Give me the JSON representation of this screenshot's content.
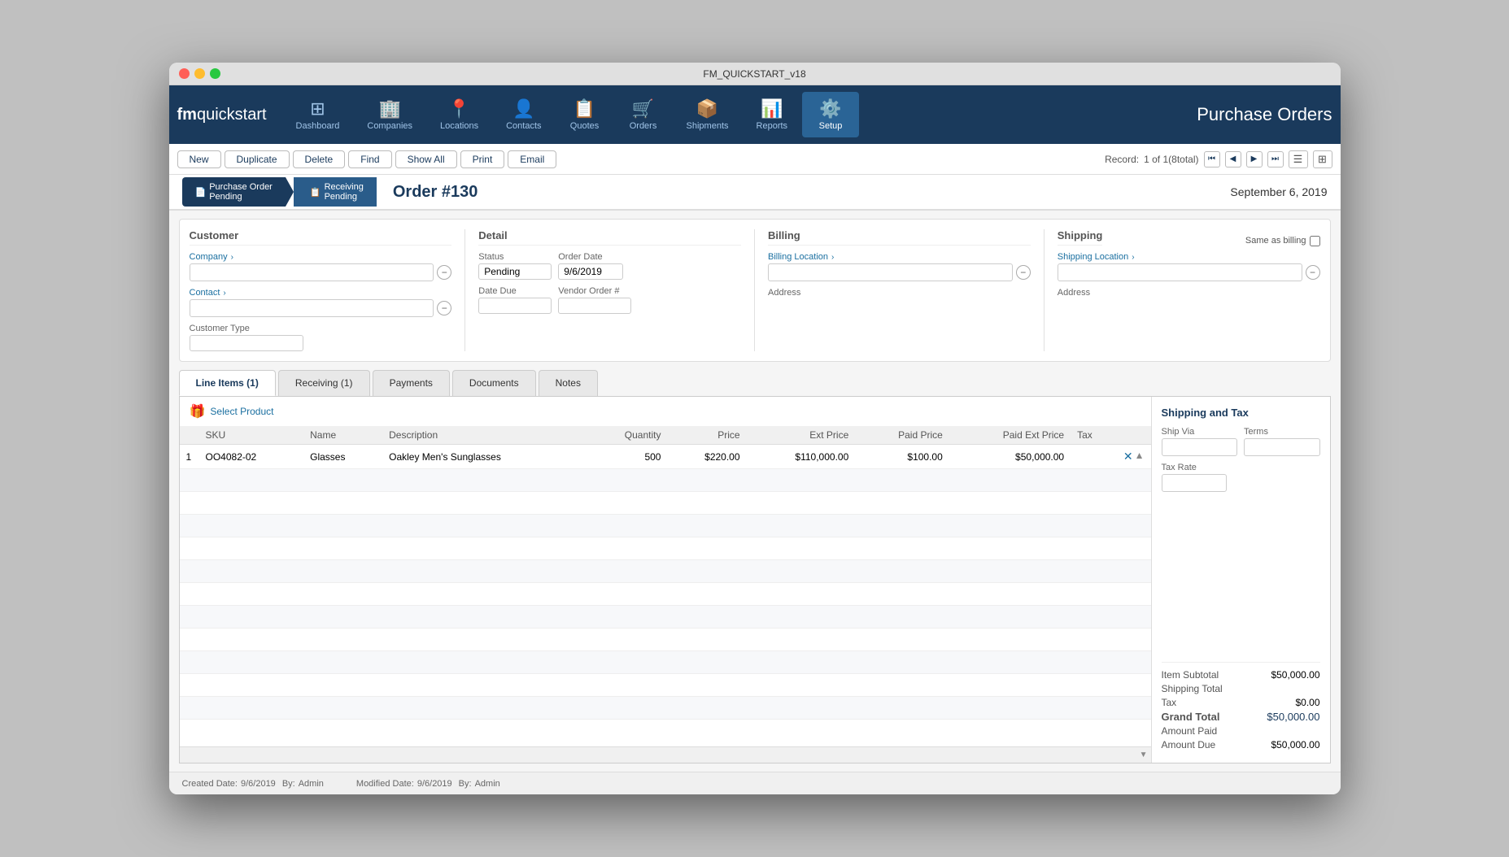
{
  "window": {
    "title": "FM_QUICKSTART_v18"
  },
  "nav": {
    "app_title_light": "fm",
    "app_title_bold": "quickstart",
    "items": [
      {
        "id": "dashboard",
        "label": "Dashboard",
        "icon": "⊞",
        "active": false
      },
      {
        "id": "companies",
        "label": "Companies",
        "icon": "🏢",
        "active": false
      },
      {
        "id": "locations",
        "label": "Locations",
        "icon": "📍",
        "active": false
      },
      {
        "id": "contacts",
        "label": "Contacts",
        "icon": "👤",
        "active": false
      },
      {
        "id": "quotes",
        "label": "Quotes",
        "icon": "📋",
        "active": false
      },
      {
        "id": "orders",
        "label": "Orders",
        "icon": "🛒",
        "active": false
      },
      {
        "id": "shipments",
        "label": "Shipments",
        "icon": "📦",
        "active": false
      },
      {
        "id": "reports",
        "label": "Reports",
        "icon": "📊",
        "active": false
      },
      {
        "id": "setup",
        "label": "Setup",
        "icon": "⚙️",
        "active": true
      }
    ],
    "module_title": "Purchase Orders"
  },
  "toolbar": {
    "buttons": [
      "New",
      "Duplicate",
      "Delete",
      "Find",
      "Show All",
      "Print",
      "Email"
    ],
    "record_label": "Record:",
    "record_current": "1",
    "record_total": "1(8total)",
    "nav_first": "⏮",
    "nav_prev": "◀",
    "nav_next": "▶",
    "nav_last": "⏭"
  },
  "status_bar": {
    "step1_label": "Purchase Order",
    "step1_sub": "Pending",
    "step2_label": "Receiving",
    "step2_sub": "Pending",
    "order_title": "Order #130",
    "order_date": "September 6, 2019"
  },
  "form": {
    "customer": {
      "title": "Customer",
      "company_label": "Company",
      "contact_label": "Contact",
      "customer_type_label": "Customer Type",
      "company_value": "",
      "contact_value": "",
      "customer_type_value": ""
    },
    "detail": {
      "title": "Detail",
      "status_label": "Status",
      "status_value": "Pending",
      "order_date_label": "Order Date",
      "order_date_value": "9/6/2019",
      "date_due_label": "Date Due",
      "date_due_value": "",
      "vendor_order_label": "Vendor Order #",
      "vendor_order_value": ""
    },
    "billing": {
      "title": "Billing",
      "location_label": "Billing Location",
      "address_label": "Address",
      "address_value": ""
    },
    "shipping": {
      "title": "Shipping",
      "same_as_billing_label": "Same as billing",
      "location_label": "Shipping Location",
      "address_label": "Address",
      "address_value": ""
    }
  },
  "tabs": [
    {
      "id": "line-items",
      "label": "Line Items (1)",
      "active": true
    },
    {
      "id": "receiving",
      "label": "Receiving (1)",
      "active": false
    },
    {
      "id": "payments",
      "label": "Payments",
      "active": false
    },
    {
      "id": "documents",
      "label": "Documents",
      "active": false
    },
    {
      "id": "notes",
      "label": "Notes",
      "active": false
    }
  ],
  "line_items": {
    "select_product_label": "Select Product",
    "columns": [
      "SKU",
      "Name",
      "Description",
      "Quantity",
      "Price",
      "Ext Price",
      "Paid Price",
      "Paid Ext Price",
      "Tax"
    ],
    "rows": [
      {
        "num": "1",
        "sku": "OO4082-02",
        "name": "Glasses",
        "description": "Oakley Men's Sunglasses",
        "quantity": "500",
        "price": "$220.00",
        "ext_price": "$110,000.00",
        "paid_price": "$100.00",
        "paid_ext_price": "$50,000.00",
        "tax": ""
      }
    ]
  },
  "shipping_tax": {
    "title": "Shipping and Tax",
    "ship_via_label": "Ship Via",
    "ship_via_value": "",
    "terms_label": "Terms",
    "terms_value": "",
    "tax_rate_label": "Tax Rate",
    "tax_rate_value": ""
  },
  "totals": {
    "item_subtotal_label": "Item Subtotal",
    "item_subtotal_value": "$50,000.00",
    "shipping_total_label": "Shipping Total",
    "shipping_total_value": "",
    "tax_label": "Tax",
    "tax_value": "$0.00",
    "grand_total_label": "Grand Total",
    "grand_total_value": "$50,000.00",
    "amount_paid_label": "Amount Paid",
    "amount_paid_value": "",
    "amount_due_label": "Amount Due",
    "amount_due_value": "$50,000.00"
  },
  "footer": {
    "created_label": "Created Date:",
    "created_date": "9/6/2019",
    "created_by_label": "By:",
    "created_by": "Admin",
    "modified_label": "Modified Date:",
    "modified_date": "9/6/2019",
    "modified_by_label": "By:",
    "modified_by": "Admin"
  }
}
